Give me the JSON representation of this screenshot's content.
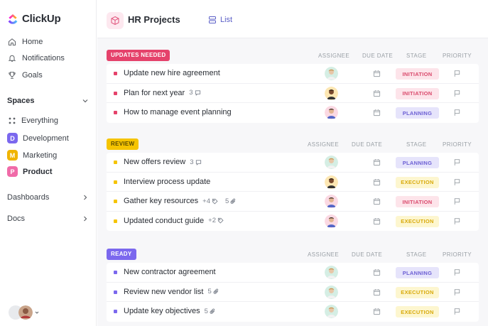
{
  "app": {
    "name": "ClickUp"
  },
  "sidebar": {
    "nav": [
      {
        "label": "Home",
        "icon": "home-icon"
      },
      {
        "label": "Notifications",
        "icon": "bell-icon"
      },
      {
        "label": "Goals",
        "icon": "trophy-icon"
      }
    ],
    "spaces_label": "Spaces",
    "everything_label": "Everything",
    "spaces": [
      {
        "letter": "D",
        "label": "Development",
        "color": "#7b68ee",
        "active": false
      },
      {
        "letter": "M",
        "label": "Marketing",
        "color": "#f0b400",
        "active": false
      },
      {
        "letter": "P",
        "label": "Product",
        "color": "#f06ba8",
        "active": true
      }
    ],
    "dashboards_label": "Dashboards",
    "docs_label": "Docs"
  },
  "header": {
    "title": "HR Projects",
    "view_label": "List"
  },
  "columns": {
    "assignee": "ASSIGNEE",
    "due_date": "DUE DATE",
    "stage": "STAGE",
    "priority": "PRIORITY"
  },
  "groups": [
    {
      "tag": "UPDATES NEEDED",
      "tag_color": "#e5426b",
      "bullet_color": "#e5426b",
      "tasks": [
        {
          "name": "Update new hire agreement",
          "stage": "INITIATION",
          "avatar": "a"
        },
        {
          "name": "Plan for next year",
          "meta": "3",
          "meta_icon": "comment-icon",
          "stage": "INITIATION",
          "avatar": "b"
        },
        {
          "name": "How to manage event planning",
          "stage": "PLANNING",
          "avatar": "c"
        }
      ]
    },
    {
      "tag": "REVIEW",
      "tag_color": "#f5c400",
      "bullet_color": "#f5c400",
      "tasks": [
        {
          "name": "New offers review",
          "meta": "3",
          "meta_icon": "comment-icon",
          "stage": "PLANNING",
          "avatar": "a"
        },
        {
          "name": "Interview process update",
          "stage": "EXECUTION",
          "avatar": "b"
        },
        {
          "name": "Gather key resources",
          "meta": "+4",
          "meta_icon": "tag-icon",
          "meta2": "5",
          "meta2_icon": "paperclip-icon",
          "stage": "INITIATION",
          "avatar": "c"
        },
        {
          "name": "Updated conduct guide",
          "meta": "+2",
          "meta_icon": "tag-icon",
          "stage": "EXECUTION",
          "avatar": "c"
        }
      ]
    },
    {
      "tag": "READY",
      "tag_color": "#7b68ee",
      "bullet_color": "#7b68ee",
      "tasks": [
        {
          "name": "New contractor agreement",
          "stage": "PLANNING",
          "avatar": "a"
        },
        {
          "name": "Review new vendor list",
          "meta": "5",
          "meta_icon": "paperclip-icon",
          "stage": "EXECUTION",
          "avatar": "a"
        },
        {
          "name": "Update key objectives",
          "meta": "5",
          "meta_icon": "paperclip-icon",
          "stage": "EXECUTION",
          "avatar": "a"
        }
      ]
    }
  ],
  "stage_styles": {
    "INITIATION": {
      "bg": "#fde4ea",
      "fg": "#d9486b"
    },
    "PLANNING": {
      "bg": "#e6e4fb",
      "fg": "#6c5fd4"
    },
    "EXECUTION": {
      "bg": "#fdf6cf",
      "fg": "#d8a90a"
    }
  }
}
